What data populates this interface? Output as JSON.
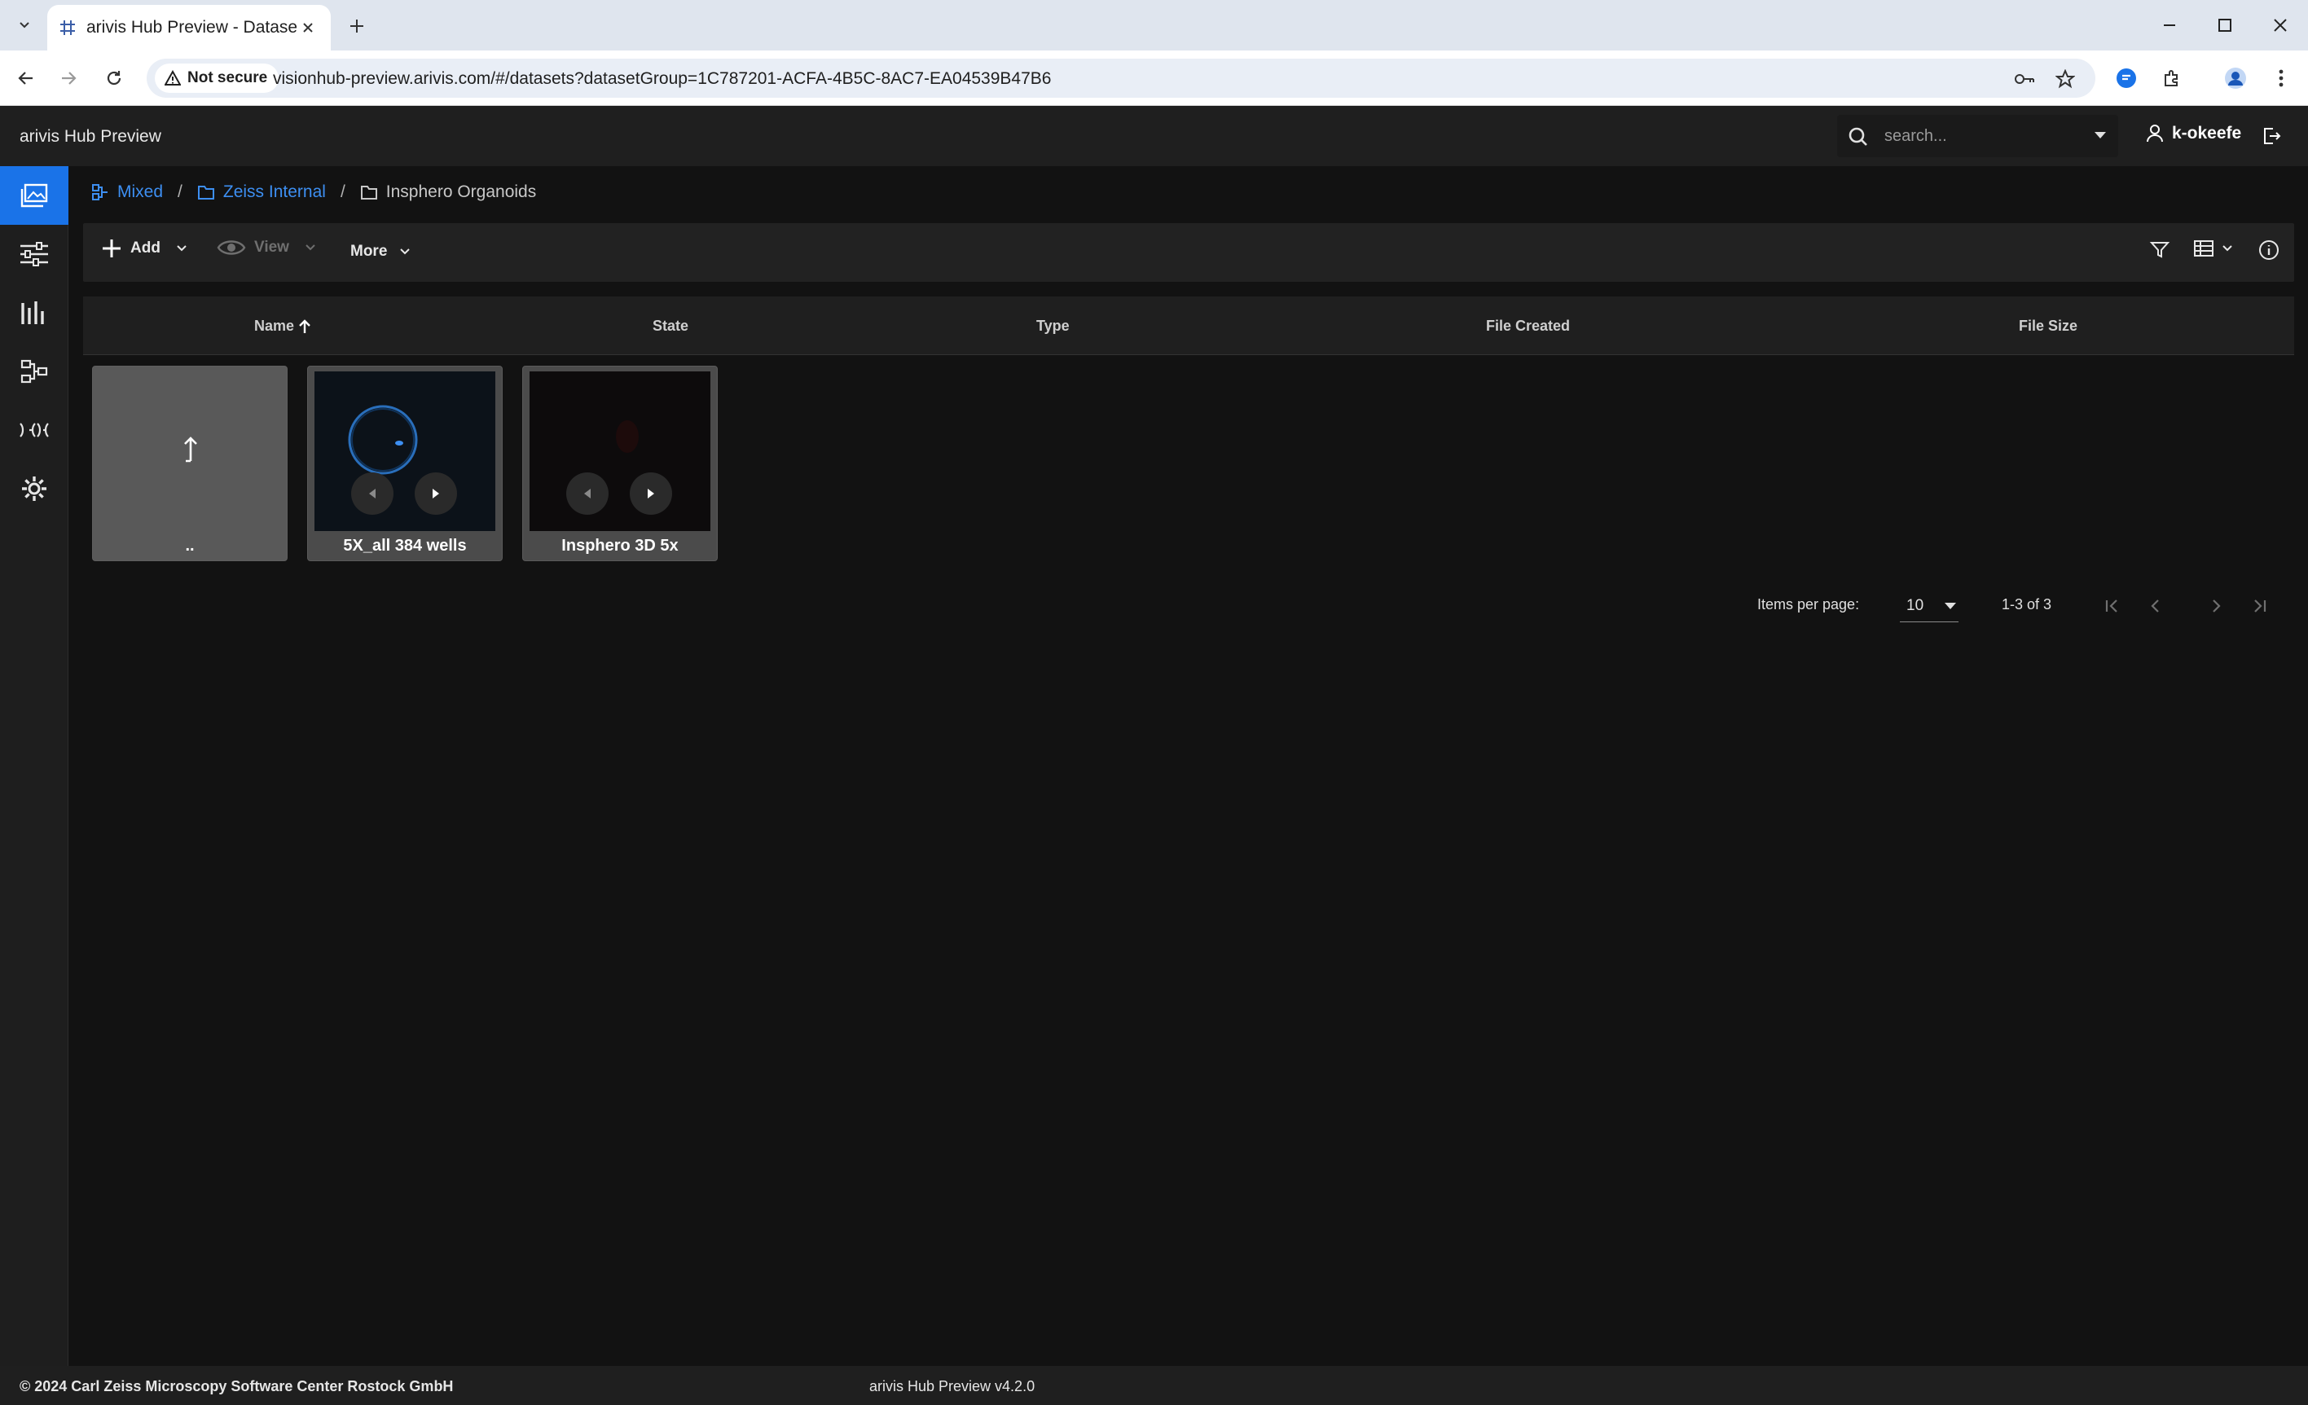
{
  "browser": {
    "tab_title": "arivis Hub Preview - Datasets",
    "security_label": "Not secure",
    "url": "visionhub-preview.arivis.com/#/datasets?datasetGroup=1C787201-ACFA-4B5C-8AC7-EA04539B47B6"
  },
  "app": {
    "title": "arivis Hub Preview",
    "search_placeholder": "search...",
    "username": "k-okeefe"
  },
  "breadcrumb": [
    {
      "label": "Mixed",
      "icon": "group-icon"
    },
    {
      "label": "Zeiss Internal",
      "icon": "folder-icon"
    },
    {
      "label": "Insphero Organoids",
      "icon": "folder-icon"
    }
  ],
  "actions": {
    "add": "Add",
    "view": "View",
    "more": "More"
  },
  "columns": {
    "name": "Name",
    "state": "State",
    "type": "Type",
    "file_created": "File Created",
    "file_size": "File Size"
  },
  "cards": [
    {
      "label": ".."
    },
    {
      "label": "5X_all 384 wells"
    },
    {
      "label": "Insphero 3D 5x"
    }
  ],
  "paginator": {
    "items_per_page_label": "Items per page:",
    "page_size": "10",
    "range": "1-3 of 3"
  },
  "footer": {
    "copyright": "© 2024 Carl Zeiss Microscopy Software Center Rostock GmbH",
    "version": "arivis Hub Preview v4.2.0"
  },
  "colors": {
    "accent": "#1a73e8",
    "link": "#3d8ff2",
    "background": "#121212"
  }
}
